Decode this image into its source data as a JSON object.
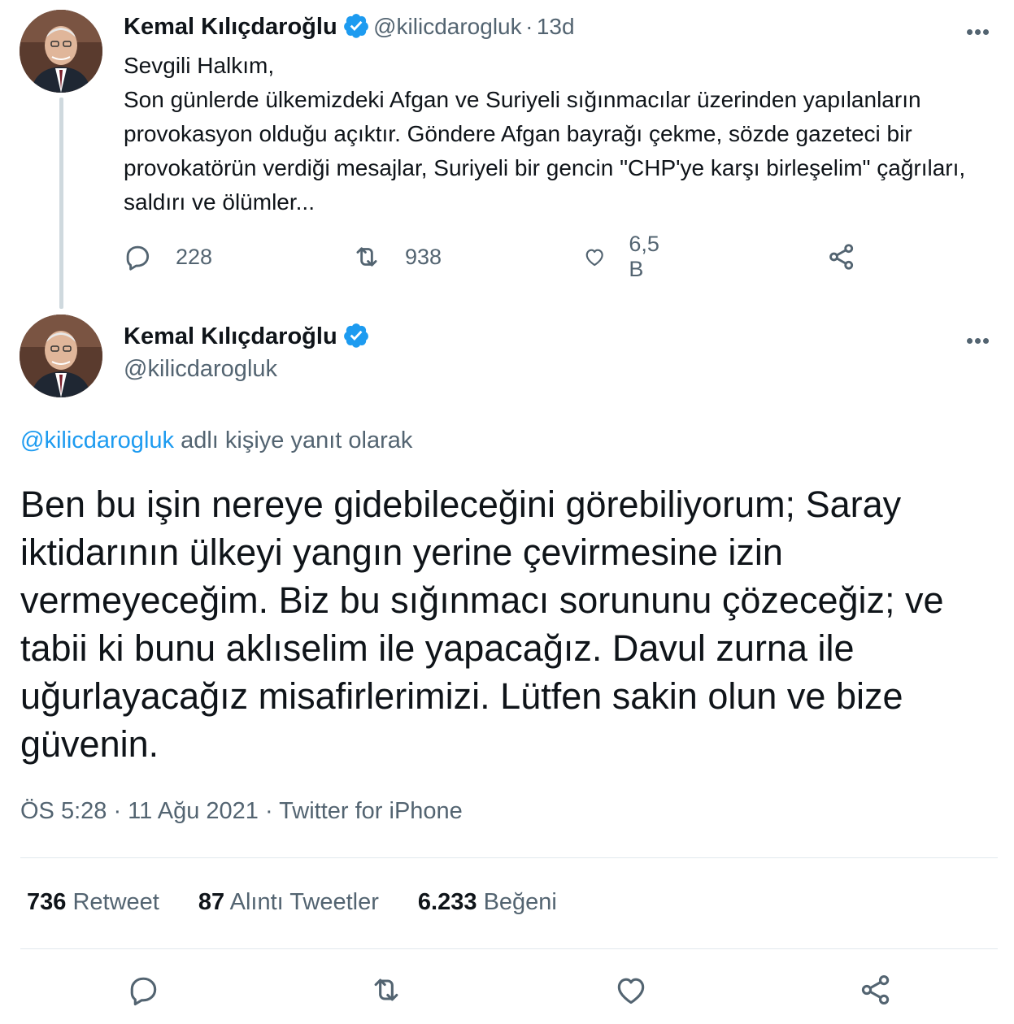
{
  "thread_tweet": {
    "author_name": "Kemal Kılıçdaroğlu",
    "handle": "@kilicdarogluk",
    "separator": "·",
    "time_ago": "13d",
    "text": "Sevgili Halkım,\nSon günlerde ülkemizdeki Afgan ve Suriyeli sığınmacılar üzerinden yapılanların provokasyon olduğu açıktır. Göndere Afgan bayrağı çekme, sözde gazeteci bir provokatörün verdiği mesajlar, Suriyeli bir gencin \"CHP'ye karşı birleşelim\" çağrıları, saldırı ve ölümler...",
    "replies": "228",
    "retweets": "938",
    "likes": "6,5 B"
  },
  "main_tweet": {
    "author_name": "Kemal Kılıçdaroğlu",
    "handle": "@kilicdarogluk",
    "reply_mention": "@kilicdarogluk",
    "reply_suffix": " adlı kişiye yanıt olarak",
    "text": "Ben bu işin nereye gidebileceğini görebiliyorum; Saray iktidarının ülkeyi yangın yerine çevirmesine izin vermeyeceğim. Biz bu sığınmacı sorununu çözeceğiz; ve tabii ki bunu aklıselim ile yapacağız. Davul zurna ile uğurlayacağız misafirlerimizi. Lütfen sakin olun ve bize güvenin.",
    "meta": "ÖS 5:28 · 11 Ağu 2021 · Twitter for iPhone",
    "stats": [
      {
        "count": "736",
        "label": "Retweet"
      },
      {
        "count": "87",
        "label": "Alıntı Tweetler"
      },
      {
        "count": "6.233",
        "label": "Beğeni"
      }
    ]
  },
  "colors": {
    "accent": "#1d9bf0",
    "muted": "#536471",
    "text": "#0f1419"
  },
  "icons": [
    "verified-badge-icon",
    "more-options-icon",
    "reply-icon",
    "retweet-icon",
    "like-icon",
    "share-icon"
  ]
}
